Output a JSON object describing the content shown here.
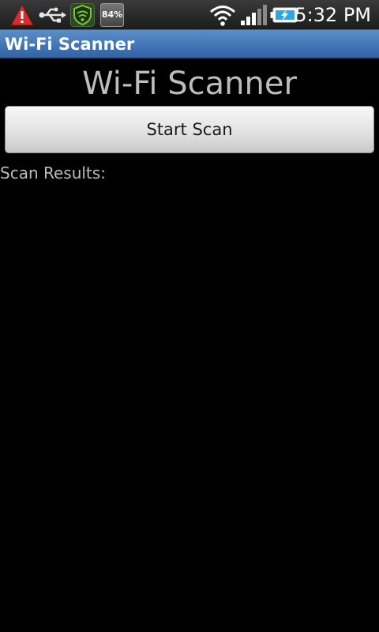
{
  "status_bar": {
    "icons": [
      "warning-icon",
      "usb-icon",
      "shield-icon",
      "battery-percent-badge",
      "wifi-icon",
      "signal-icon",
      "battery-charging-icon"
    ],
    "battery_badge_text": "84%",
    "time": "5:32 PM",
    "colors": {
      "warning": "#d32f2f",
      "shield": "#7cc245",
      "battery": "#2ea7e0"
    }
  },
  "title_bar": {
    "title": "Wi-Fi Scanner",
    "color": "#3a72b8"
  },
  "main": {
    "heading": "Wi-Fi Scanner",
    "start_button_label": "Start Scan",
    "results_label": "Scan Results:",
    "results": []
  }
}
